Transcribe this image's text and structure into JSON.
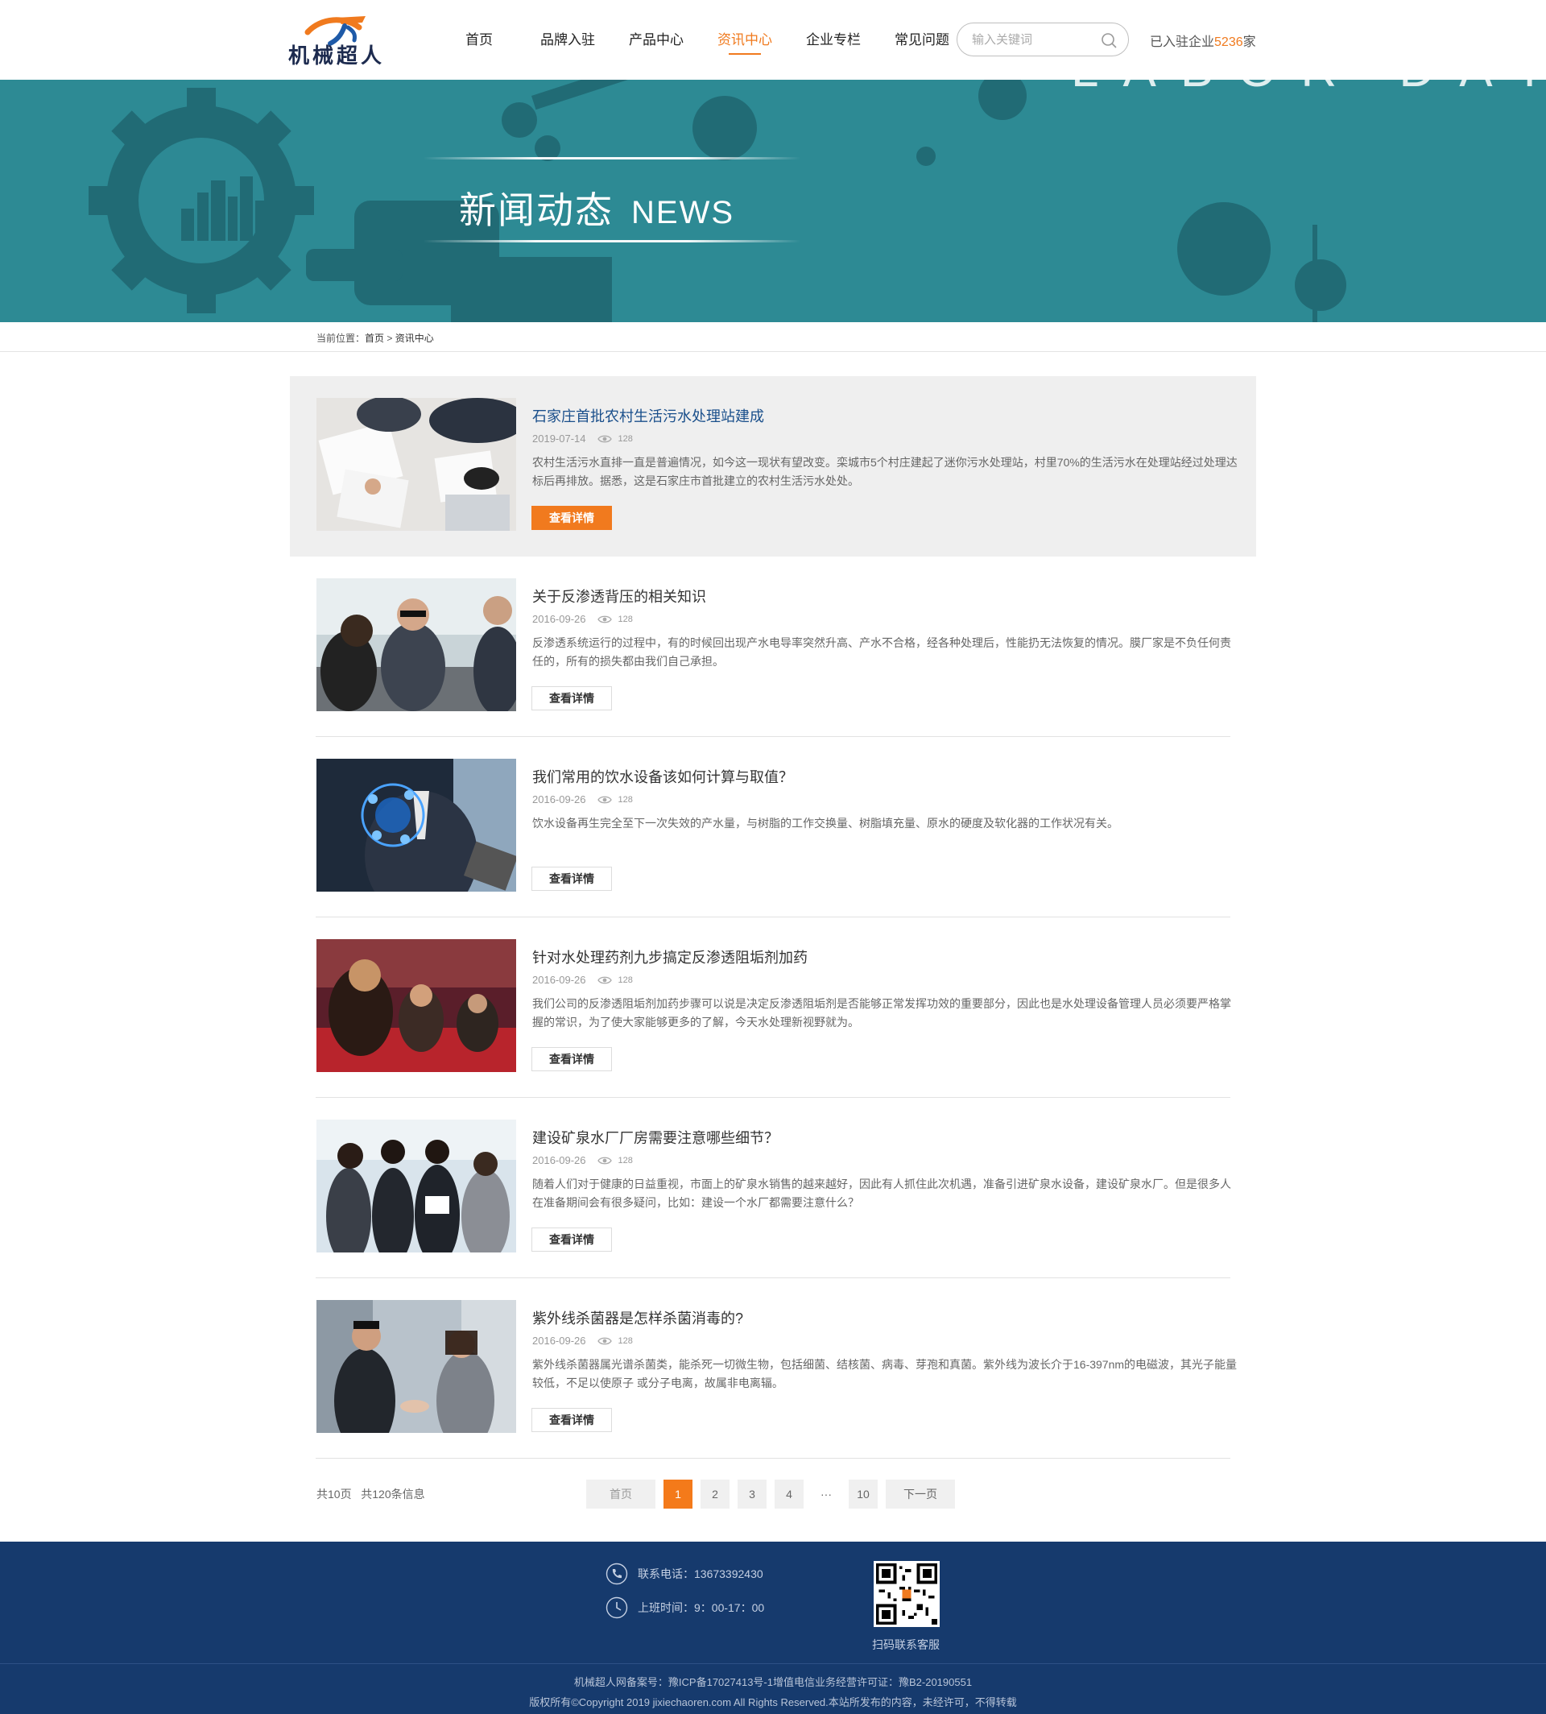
{
  "header": {
    "logo_text": "机械超人",
    "nav": [
      {
        "label": "首页",
        "active": false
      },
      {
        "label": "品牌入驻",
        "active": false
      },
      {
        "label": "产品中心",
        "active": false
      },
      {
        "label": "资讯中心",
        "active": true
      },
      {
        "label": "企业专栏",
        "active": false
      },
      {
        "label": "常见问题",
        "active": false
      }
    ],
    "search_placeholder": "输入关键词",
    "settled_prefix": "已入驻企业",
    "settled_count": "5236",
    "settled_suffix": "家"
  },
  "banner": {
    "title_cn": "新闻动态",
    "title_en": "NEWS",
    "bg_text": "LABOR DAY",
    "colors": {
      "background": "#2d8a94",
      "shapes": "#1f6670"
    }
  },
  "breadcrumb": {
    "prefix": "当前位置：",
    "home": "首页",
    "separator": ">",
    "current": "资讯中心"
  },
  "news": [
    {
      "title": "石家庄首批农村生活污水处理站建成",
      "date": "2019-07-14",
      "views": "128",
      "summary": "农村生活污水直排一直是普遍情况，如今这一现状有望改变。栾城市5个村庄建起了迷你污水处理站，村里70%的生活污水在处理站经过处理达标后再排放。据悉，这是石家庄市首批建立的农村生活污水处处。",
      "button": "查看详情",
      "highlight": true
    },
    {
      "title": "关于反渗透背压的相关知识",
      "date": "2016-09-26",
      "views": "128",
      "summary": "反渗透系统运行的过程中，有的时候回出现产水电导率突然升高、产水不合格，经各种处理后，性能扔无法恢复的情况。膜厂家是不负任何责任的，所有的损失都由我们自己承担。",
      "button": "查看详情",
      "highlight": false
    },
    {
      "title": "我们常用的饮水设备该如何计算与取值？",
      "date": "2016-09-26",
      "views": "128",
      "summary": "饮水设备再生完全至下一次失效的产水量，与树脂的工作交换量、树脂填充量、原水的硬度及软化器的工作状况有关。",
      "button": "查看详情",
      "highlight": false
    },
    {
      "title": "针对水处理药剂九步搞定反渗透阻垢剂加药",
      "date": "2016-09-26",
      "views": "128",
      "summary": "我们公司的反渗透阻垢剂加药步骤可以说是决定反渗透阻垢剂是否能够正常发挥功效的重要部分，因此也是水处理设备管理人员必须要严格掌握的常识，为了使大家能够更多的了解，今天水处理新视野就为。",
      "button": "查看详情",
      "highlight": false
    },
    {
      "title": "建设矿泉水厂厂房需要注意哪些细节？",
      "date": "2016-09-26",
      "views": "128",
      "summary": "随着人们对于健康的日益重视，市面上的矿泉水销售的越来越好，因此有人抓住此次机遇，准备引进矿泉水设备，建设矿泉水厂。但是很多人在准备期间会有很多疑问，比如：建设一个水厂都需要注意什么？",
      "button": "查看详情",
      "highlight": false
    },
    {
      "title": "紫外线杀菌器是怎样杀菌消毒的?",
      "date": "2016-09-26",
      "views": "128",
      "summary": "紫外线杀菌器属光谱杀菌类，能杀死一切微生物，包括细菌、结核菌、病毒、芽孢和真菌。紫外线为波长介于16-397nm的电磁波，其光子能量较低，不足以使原子 或分子电离，故属非电离辐。",
      "button": "查看详情",
      "highlight": false
    }
  ],
  "pagination": {
    "total_pages": "共10页",
    "total_items": "共120条信息",
    "first": "首页",
    "pages": [
      "1",
      "2",
      "3",
      "4"
    ],
    "ellipsis": "···",
    "last_page": "10",
    "next": "下一页",
    "current": "1"
  },
  "footer": {
    "phone": "联系电话：13673392430",
    "hours": "上班时间：9：00-17：00",
    "qr_label": "扫码联系客服",
    "icp": "机械超人网备案号：豫ICP备17027413号-1增值电信业务经营许可证：豫B2-20190551",
    "copyright": "版权所有©Copyright 2019 jixiechaoren.com All Rights Reserved.本站所发布的内容，未经许可，不得转载"
  }
}
